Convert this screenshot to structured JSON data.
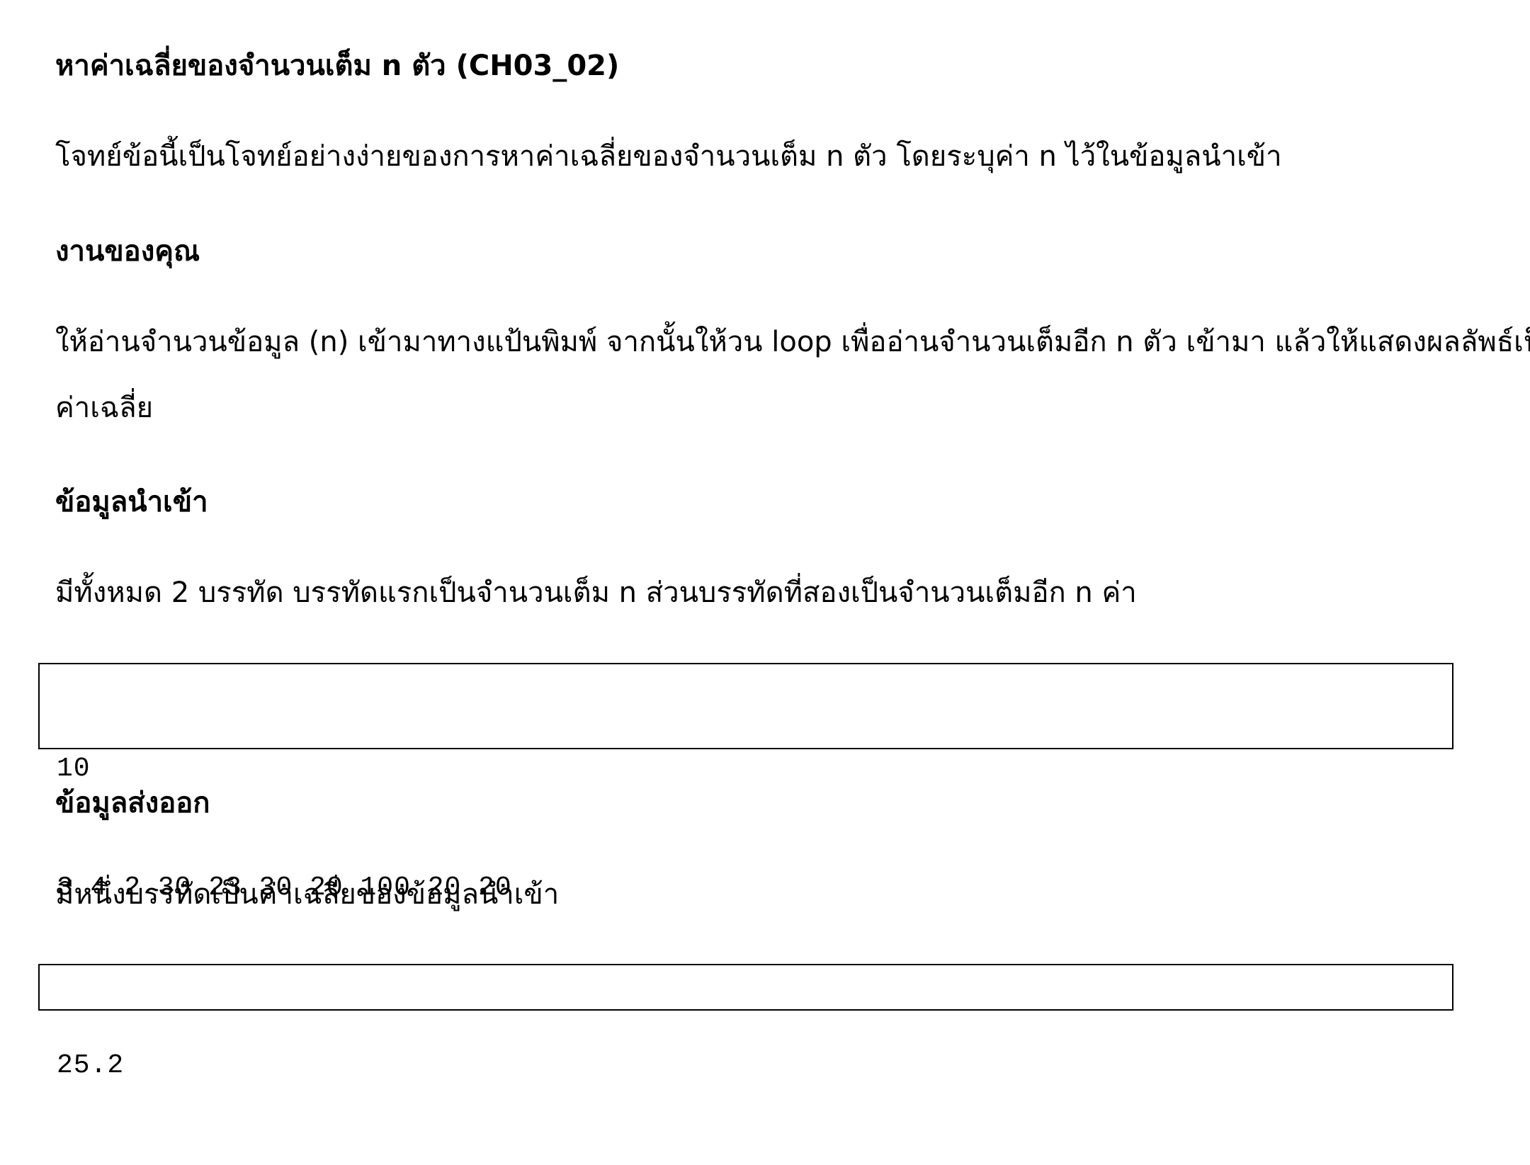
{
  "title": "หาค่าเฉลี่ยของจำนวนเต็ม n ตัว (CH03_02)",
  "intro": "โจทย์ข้อนี้เป็นโจทย์อย่างง่ายของการหาค่าเฉลี่ยของจำนวนเต็ม n ตัว โดยระบุค่า n ไว้ในข้อมูลนำเข้า",
  "task": {
    "heading": "งานของคุณ",
    "line1": "ให้อ่านจำนวนข้อมูล (n) เข้ามาทางแป้นพิมพ์ จากนั้นให้วน loop เพื่ออ่านจำนวนเต็มอีก n ตัว เข้ามา แล้วให้แสดงผลลัพธ์เป็น",
    "line2": "ค่าเฉลี่ย"
  },
  "input": {
    "heading": "ข้อมูลนำเข้า",
    "description": "มีทั้งหมด 2 บรรทัด บรรทัดแรกเป็นจำนวนเต็ม n  ส่วนบรรทัดที่สองเป็นจำนวนเต็มอีก n ค่า",
    "sample_lines": [
      "10",
      "3 4 2 30 23 30 20 100 20 20"
    ]
  },
  "output": {
    "heading": "ข้อมูลส่งออก",
    "description": "มีหนึ่งบรรทัดเป็นค่าเฉลี่ยของข้อมูลนำเข้า",
    "sample_lines": [
      "25.2"
    ]
  }
}
